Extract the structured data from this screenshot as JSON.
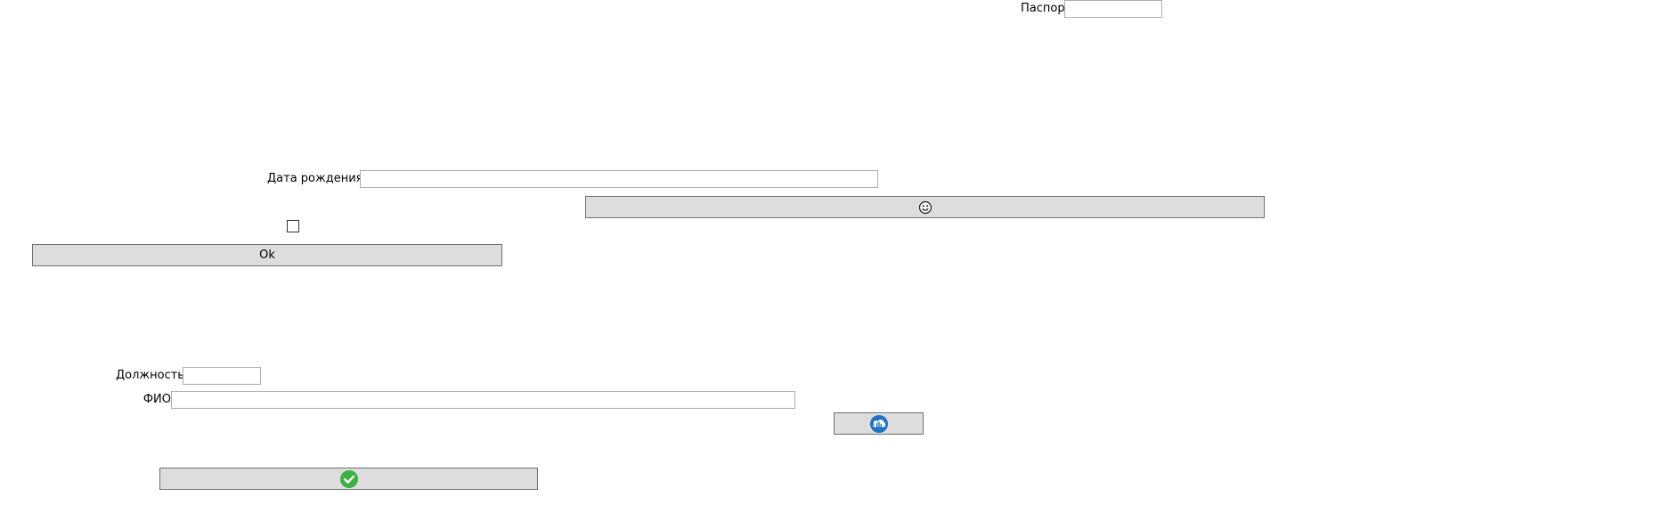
{
  "form": {
    "passport_label": "Паспорт",
    "passport_value": "",
    "birthdate_label": "Дата рождения",
    "birthdate_value": "",
    "position_label": "Должность",
    "position_value": "",
    "fullname_label": "ФИО",
    "fullname_value": "",
    "ok_label": "Ok",
    "checkbox_checked": false
  },
  "icons": {
    "smiley_button": "smiley-icon",
    "cloud_button": "cloud-upload-icon",
    "confirm_button": "check-circle-icon"
  },
  "colors": {
    "button_bg": "#dddddd",
    "button_border": "#707070",
    "cloud_icon": "#1e73c4",
    "check_icon": "#3cb043"
  }
}
